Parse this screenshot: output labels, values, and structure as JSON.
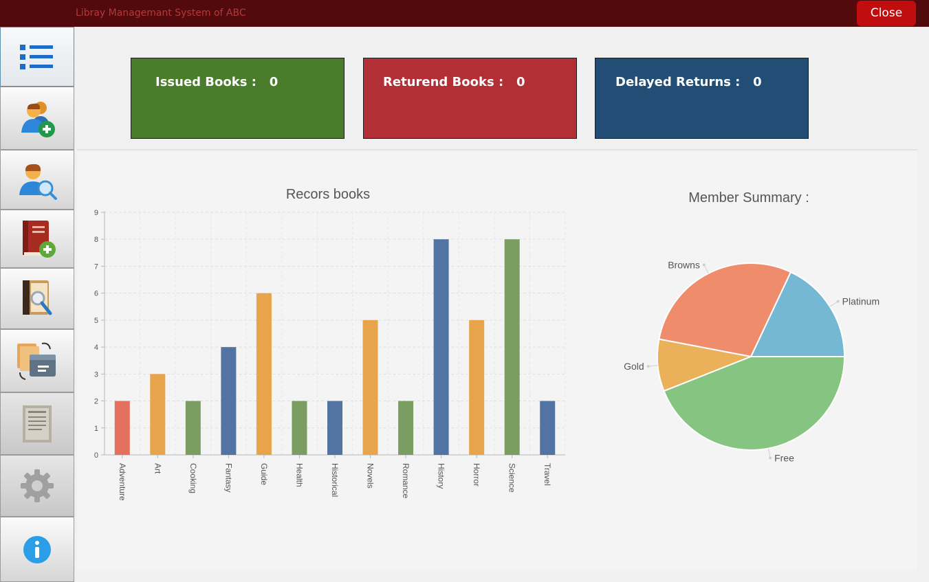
{
  "window": {
    "title": "Libray Managemant System of ABC",
    "close_label": "Close"
  },
  "sidebar": {
    "items": [
      {
        "icon": "dashboard-list-icon",
        "active": true,
        "enabled": true
      },
      {
        "icon": "add-member-icon",
        "active": false,
        "enabled": true
      },
      {
        "icon": "search-member-icon",
        "active": false,
        "enabled": true
      },
      {
        "icon": "add-book-icon",
        "active": false,
        "enabled": true
      },
      {
        "icon": "search-book-icon",
        "active": false,
        "enabled": true
      },
      {
        "icon": "issue-return-icon",
        "active": false,
        "enabled": true
      },
      {
        "icon": "reports-icon",
        "active": false,
        "enabled": false
      },
      {
        "icon": "settings-gear-icon",
        "active": false,
        "enabled": false
      },
      {
        "icon": "info-icon",
        "active": false,
        "enabled": true
      }
    ]
  },
  "stats": {
    "issued": {
      "label": "Issued Books :   0",
      "color": "#4a7d2b"
    },
    "returned": {
      "label": "Returend Books :   0",
      "color": "#b12f35"
    },
    "delayed": {
      "label": "Delayed Returns :   0",
      "color": "#224e76"
    }
  },
  "chart_data": [
    {
      "type": "bar",
      "title": "Recors books",
      "xlabel": "",
      "ylabel": "",
      "ylim": [
        0,
        9
      ],
      "yticks": [
        0,
        1,
        2,
        3,
        4,
        5,
        6,
        7,
        8,
        9
      ],
      "grid": true,
      "categories": [
        "Adventure",
        "Art",
        "Cooking",
        "Fantasy",
        "Guide",
        "Health",
        "Historical",
        "Novels",
        "Romance",
        "History",
        "Horror",
        "Science",
        "Travel"
      ],
      "values": [
        2,
        3,
        2,
        4,
        6,
        2,
        2,
        5,
        2,
        8,
        5,
        8,
        2
      ],
      "colors": [
        "#e4705f",
        "#e8a44b",
        "#7a9e62",
        "#5274a3",
        "#e8a44b",
        "#7a9e62",
        "#5274a3",
        "#e8a44b",
        "#7a9e62",
        "#5274a3",
        "#e8a44b",
        "#7a9e62",
        "#5274a3"
      ]
    },
    {
      "type": "pie",
      "title": "Member Summary :",
      "labels": [
        "Platinum",
        "Browns",
        "Gold",
        "Free"
      ],
      "values": [
        18,
        29,
        9,
        44
      ],
      "colors": [
        "#74b8d3",
        "#ee8c6c",
        "#ebb15a",
        "#86c482"
      ]
    }
  ]
}
